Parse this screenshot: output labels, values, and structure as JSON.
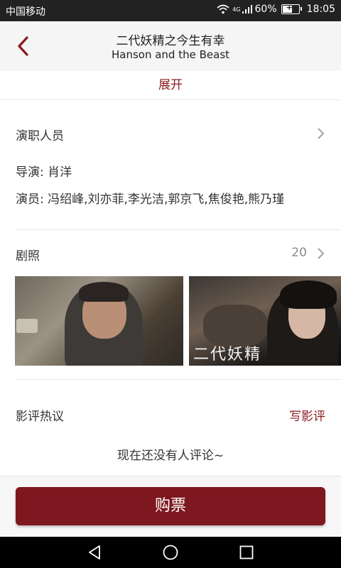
{
  "status_bar": {
    "carrier": "中国移动",
    "network": "4G",
    "battery": "60%",
    "battery_level": 0.6,
    "time": "18:05"
  },
  "header": {
    "title_cn": "二代妖精之今生有幸",
    "title_en": "Hanson and the Beast",
    "back_icon": "chevron-left-icon"
  },
  "expand_label": "展开",
  "cast_section": {
    "label": "演职人员",
    "director": "导演: 肖洋",
    "actors": "演员: 冯绍峰,刘亦菲,李光洁,郭京飞,焦俊艳,熊乃瑾"
  },
  "stills_section": {
    "label": "剧照",
    "count": "20",
    "still2_watermark": "二代妖精"
  },
  "reviews_section": {
    "label": "影评热议",
    "write_label": "写影评",
    "empty_text": "现在还没有人评论~"
  },
  "buy_button": "购票",
  "colors": {
    "accent": "#8b1a1f",
    "button": "#7e1820"
  }
}
